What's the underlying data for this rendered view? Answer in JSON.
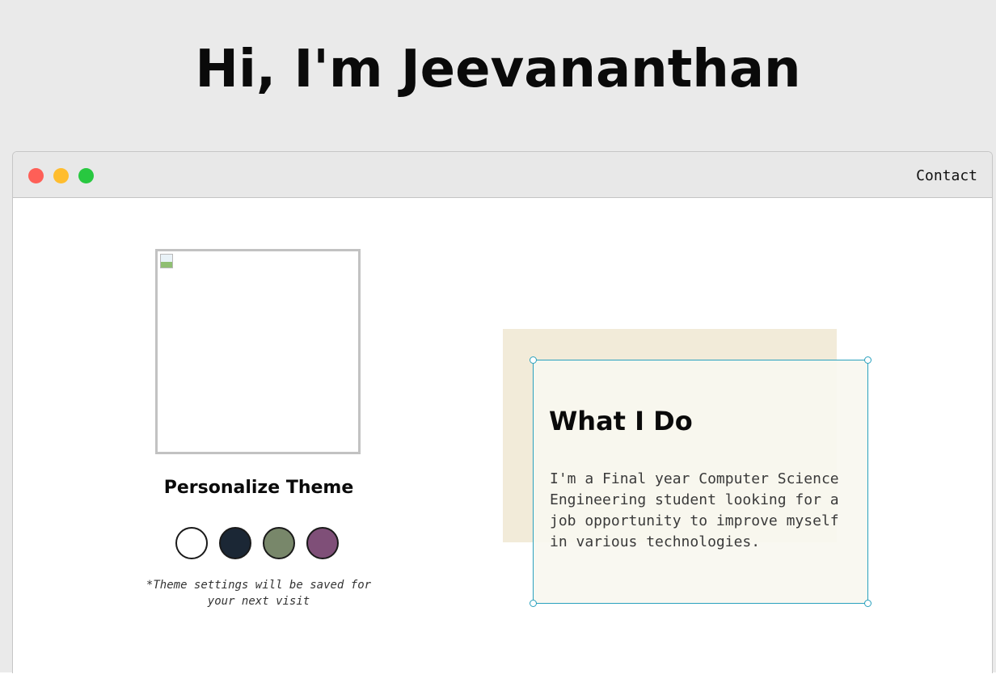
{
  "hero": {
    "title": "Hi, I'm Jeevananthan"
  },
  "window": {
    "controls": [
      "close",
      "minimize",
      "maximize"
    ],
    "nav": {
      "contact_label": "Contact"
    }
  },
  "profile": {
    "image_state": "broken-image"
  },
  "theme": {
    "heading": "Personalize Theme",
    "swatches": [
      {
        "name": "light",
        "color": "#ffffff"
      },
      {
        "name": "dark",
        "color": "#1b2735"
      },
      {
        "name": "green",
        "color": "#78876a"
      },
      {
        "name": "purple",
        "color": "#7f4f78"
      }
    ],
    "note": "*Theme settings will be saved for your next visit"
  },
  "about": {
    "title": "What I Do",
    "text": "I'm a Final year Computer Science Engineering student looking for a job opportunity to improve myself in various technologies."
  },
  "colors": {
    "page_background": "#eaeaea",
    "window_titlebar": "#e8e8e8",
    "accent_beige": "#f2ebd9",
    "selection_outline": "#2aa1be",
    "close_dot": "#fe5f57",
    "minimize_dot": "#ffbd2e",
    "maximize_dot": "#28c840"
  }
}
